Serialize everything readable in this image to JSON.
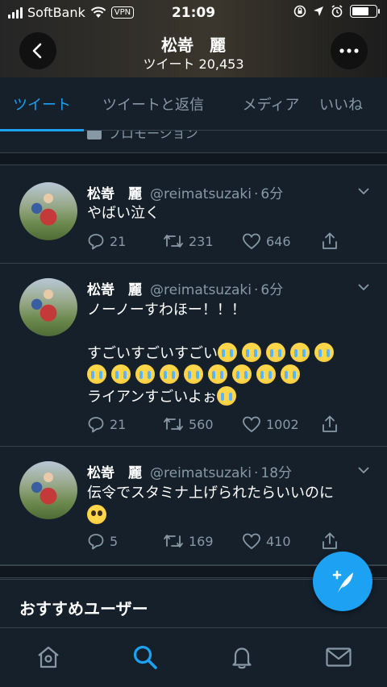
{
  "status_bar": {
    "carrier": "SoftBank",
    "vpn": "VPN",
    "time": "21:09"
  },
  "profile": {
    "name": "松嵜　麗",
    "tweet_count": "ツイート 20,453"
  },
  "tabs": [
    {
      "label": "ツイート",
      "active": true
    },
    {
      "label": "ツイートと返信",
      "active": false
    },
    {
      "label": "メディア",
      "active": false
    },
    {
      "label": "いいね",
      "active": false
    }
  ],
  "promo": {
    "label": "プロモーション"
  },
  "tweets": [
    {
      "name": "松嵜　麗",
      "handle": "@reimatsuzaki",
      "time": "6分",
      "lines": [
        "やばい泣く"
      ],
      "replies": "21",
      "retweets": "231",
      "likes": "646"
    },
    {
      "name": "松嵜　麗",
      "handle": "@reimatsuzaki",
      "time": "6分",
      "lines": [
        "ノーノーすわほー！！！",
        "",
        "すごいすごいすごい",
        "",
        "ライアンすごいよぉ"
      ],
      "replies": "21",
      "retweets": "560",
      "likes": "1002"
    },
    {
      "name": "松嵜　麗",
      "handle": "@reimatsuzaki",
      "time": "18分",
      "lines": [
        "伝令でスタミナ上げられたらいいのに"
      ],
      "replies": "5",
      "retweets": "169",
      "likes": "410"
    }
  ],
  "recommended": {
    "title": "おすすめユーザー"
  },
  "icons": {
    "back": "back-arrow-icon",
    "more": "more-dots-icon",
    "home": "home-icon",
    "search": "search-icon",
    "notifications": "bell-icon",
    "messages": "mail-icon",
    "compose": "compose-feather-icon"
  },
  "colors": {
    "accent": "#1da1f2",
    "background": "#15202b",
    "muted": "#8899a6"
  }
}
